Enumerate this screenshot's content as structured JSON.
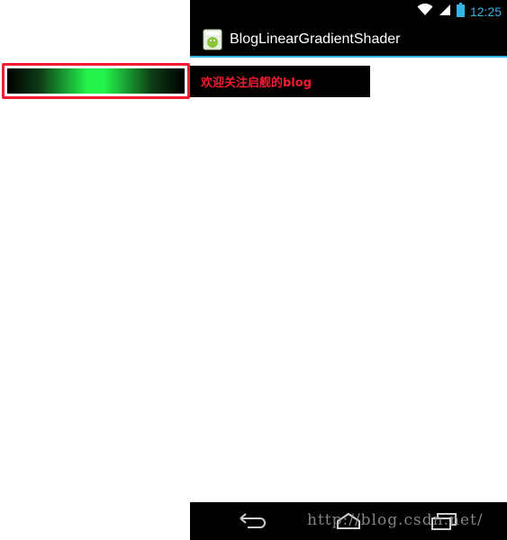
{
  "status_bar": {
    "time": "12:25",
    "clock_color": "#33b5e5",
    "icons": [
      "wifi-icon",
      "signal-icon",
      "battery-icon"
    ]
  },
  "action_bar": {
    "app_icon": "android-app-icon",
    "title": "BlogLinearGradientShader",
    "divider_color": "#33b5e5"
  },
  "content": {
    "text_label": "欢迎关注启舰的blog",
    "text_color": "#f21b30"
  },
  "demo": {
    "border_color": "#f21b30",
    "gradient_colors": [
      "#000000",
      "#22f24a",
      "#000000"
    ]
  },
  "nav_bar": {
    "buttons": [
      "back-icon",
      "home-icon",
      "recent-apps-icon"
    ]
  },
  "watermark": {
    "text": "http://blog.csdn.net/"
  }
}
